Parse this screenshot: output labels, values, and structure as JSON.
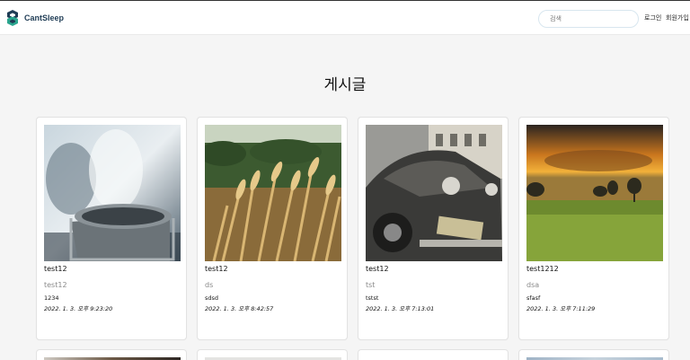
{
  "header": {
    "brand": "CantSleep",
    "search_placeholder": "검색",
    "login": "로그인",
    "signup": "회원가입"
  },
  "page": {
    "title": "게시글"
  },
  "posts": [
    {
      "title": "test12",
      "author": "test12",
      "body": "1234",
      "date": "2022. 1. 3. 오후 9:23:20"
    },
    {
      "title": "test12",
      "author": "ds",
      "body": "sdsd",
      "date": "2022. 1. 3. 오후 8:42:57"
    },
    {
      "title": "test12",
      "author": "tst",
      "body": "tstst",
      "date": "2022. 1. 3. 오후 7:13:01"
    },
    {
      "title": "test1212",
      "author": "dsa",
      "body": "sfasf",
      "date": "2022. 1. 3. 오후 7:11:29"
    }
  ],
  "colors": {
    "brand": "#1f3c55",
    "accent": "#2aa58e"
  }
}
